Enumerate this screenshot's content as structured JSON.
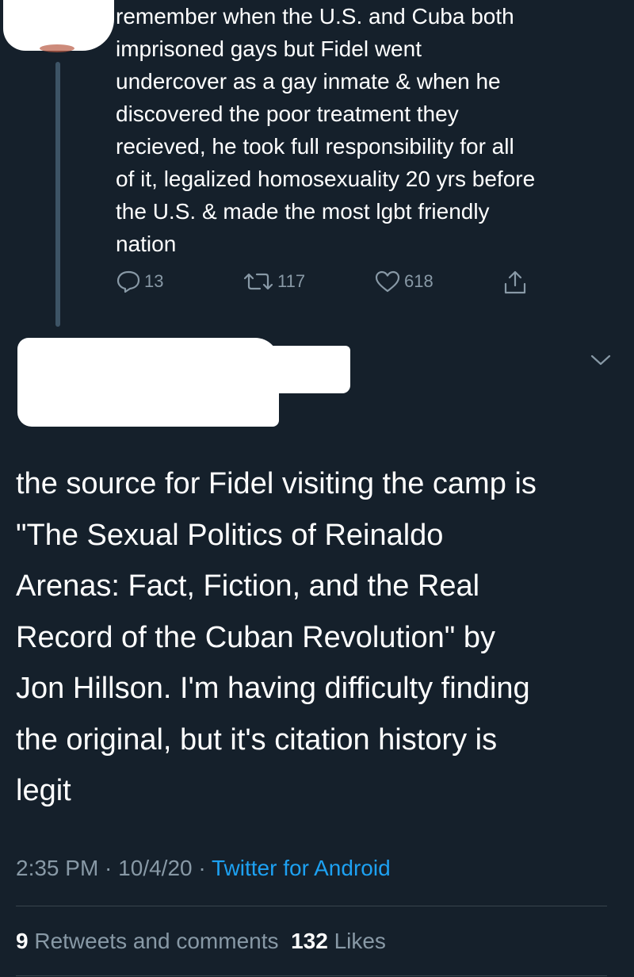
{
  "reply_tweet": {
    "text": "remember when the U.S. and Cuba both\nimprisoned gays but Fidel went\nundercover as a gay inmate & when he\ndiscovered the poor treatment they\nrecieved, he took full responsibility for all\nof it, legalized homosexuality 20 yrs before\nthe U.S. & made the most lgbt friendly\nnation",
    "actions": {
      "reply_count": "13",
      "retweet_count": "117",
      "like_count": "618"
    },
    "icons": [
      "reply-icon",
      "retweet-icon",
      "like-icon",
      "share-icon"
    ]
  },
  "main_tweet": {
    "text": "the source for Fidel visiting the camp is\n\"The Sexual Politics of Reinaldo\nArenas: Fact, Fiction, and the Real\nRecord of the Cuban Revolution\" by\nJon Hillson. I'm having difficulty finding\nthe original, but it's citation history is\nlegit",
    "time": "2:35 PM",
    "sep1": " · ",
    "date": "10/4/20",
    "sep2": " · ",
    "source": "Twitter for Android",
    "stats": {
      "retweets_count": "9",
      "retweets_label": "Retweets and comments",
      "likes_count": "132",
      "likes_label": "Likes"
    }
  },
  "colors": {
    "background": "#15202b",
    "text": "#ffffff",
    "muted": "#8899a6",
    "link": "#1da1f2",
    "divider": "#38444d"
  }
}
